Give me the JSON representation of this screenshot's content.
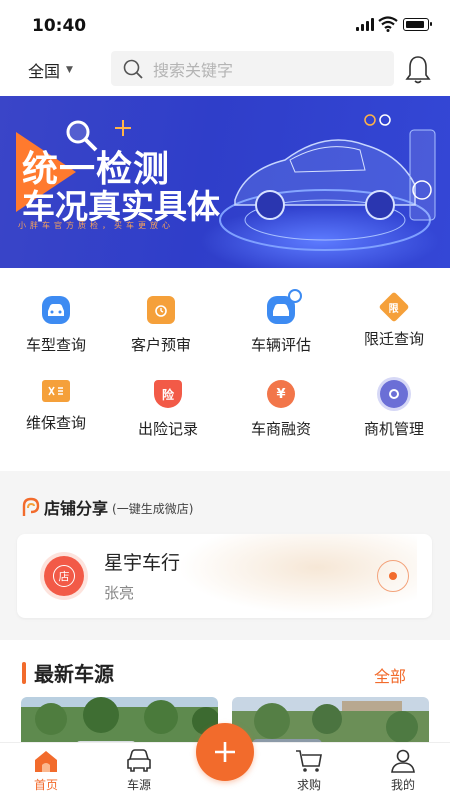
{
  "status_bar": {
    "time": "10:40"
  },
  "header": {
    "region": "全国",
    "search_placeholder": "搜索关键字"
  },
  "banner": {
    "title": "统一检测",
    "subtitle": "车况真实具体",
    "tagline": "小胖车官方质检，买车更放心",
    "active_dot": 0,
    "dot_count": 2
  },
  "features": [
    {
      "label": "车型查询",
      "icon": "car-icon",
      "color": "#3d8bf2"
    },
    {
      "label": "客户预审",
      "icon": "clock-clipboard-icon",
      "color": "#f5a03a"
    },
    {
      "label": "车辆评估",
      "icon": "car-search-icon",
      "color": "#3d8bf2"
    },
    {
      "label": "限迁查询",
      "icon": "diamond-badge-icon",
      "color": "#f5a03a"
    },
    {
      "label": "维保查询",
      "icon": "tools-icon",
      "color": "#f5a03a"
    },
    {
      "label": "出险记录",
      "icon": "shield-icon",
      "color": "#f25a47"
    },
    {
      "label": "车商融资",
      "icon": "yuan-coin-icon",
      "color": "#f2764a"
    },
    {
      "label": "商机管理",
      "icon": "target-icon",
      "color": "#6b6fd6"
    }
  ],
  "feature_icon_text": {
    "limit": "限",
    "insurance": "险",
    "finance": "¥"
  },
  "share": {
    "title": "店铺分享",
    "hint": "(一键生成微店)",
    "shop_name": "星宇车行",
    "owner": "张亮",
    "avatar_text": "店"
  },
  "latest": {
    "title": "最新车源",
    "all_link": "全部"
  },
  "tabbar": [
    {
      "label": "首页",
      "icon": "home-icon",
      "active": true
    },
    {
      "label": "车源",
      "icon": "car-front-icon",
      "active": false
    },
    {
      "label": "求购",
      "icon": "cart-icon",
      "active": false
    },
    {
      "label": "我的",
      "icon": "person-icon",
      "active": false
    }
  ],
  "colors": {
    "accent": "#f26b2c",
    "banner_bg": "#3342cf",
    "text": "#222222",
    "muted": "#888888"
  }
}
